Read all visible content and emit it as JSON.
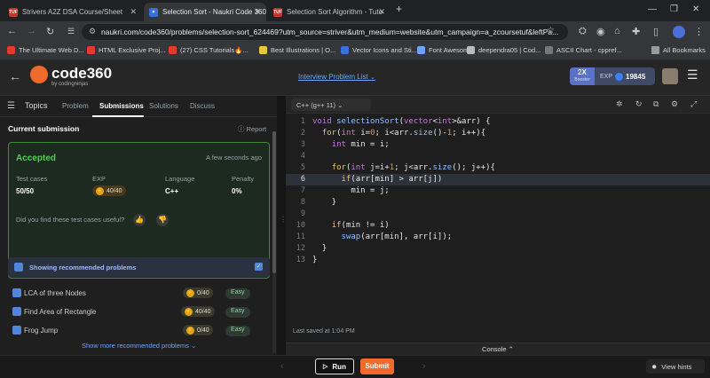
{
  "browser": {
    "tabs": [
      {
        "label": "Strivers A2Z DSA Course/Sheet",
        "active": false
      },
      {
        "label": "Selection Sort - Naukri Code 360",
        "active": true
      },
      {
        "label": "Selection Sort Algorithm - Tuto",
        "active": false
      }
    ],
    "url": "naukri.com/code360/problems/selection-sort_624469?utm_source=striver&utm_medium=website&utm_campaign=a_zcoursetuf&leftPa...",
    "bookmarks": [
      "The Ultimate Web D...",
      "HTML Exclusive Proj...",
      "(27) CSS Tutorials🔥...",
      "Best Illustrations | O...",
      "Vector Icons and Sti...",
      "Font Awesome",
      "deependra05 | Cod...",
      "ASCII Chart - cppref..."
    ],
    "all_bookmarks": "All Bookmarks"
  },
  "header": {
    "logo_main": "code",
    "logo_num": "360",
    "logo_sub": "by codingninjas",
    "center_link": "Interview Problem List",
    "booster_x": "2X",
    "booster_label": "Booster",
    "exp_label": "EXP",
    "exp_value": "19845"
  },
  "left": {
    "topics": "Topics",
    "tabs": [
      "Problem",
      "Submissions",
      "Solutions",
      "Discuss"
    ],
    "current_submission": "Current submission",
    "report": "Report",
    "status": "Accepted",
    "time": "A few seconds ago",
    "stats": [
      {
        "label": "Test cases",
        "value": "50/50"
      },
      {
        "label": "EXP",
        "value": "40/40"
      },
      {
        "label": "Language",
        "value": "C++"
      },
      {
        "label": "Penalty",
        "value": "0%"
      }
    ],
    "feedback_q": "Did you find these test cases useful?",
    "recommended_title": "Showing recommended problems",
    "recommended": [
      {
        "name": "LCA of three Nodes",
        "exp": "0/40",
        "difficulty": "Easy"
      },
      {
        "name": "Find Area of Rectangle",
        "exp": "40/40",
        "difficulty": "Easy"
      },
      {
        "name": "Frog Jump",
        "exp": "0/40",
        "difficulty": "Easy"
      }
    ],
    "show_more": "Show more recommended problems"
  },
  "editor": {
    "language": "C++ (g++ 11)",
    "line_numbers": [
      "1",
      "2",
      "3",
      "4",
      "5",
      "6",
      "7",
      "8",
      "9",
      "10",
      "11",
      "12",
      "13"
    ],
    "last_saved": "Last saved at 1:04 PM",
    "console": "Console"
  },
  "footer": {
    "run": "Run",
    "submit": "Submit",
    "view_hints": "View hints"
  },
  "colors": {
    "accepted": "#5cc85c",
    "submit_bg": "#f06b2b",
    "link_blue": "#6aa4ff"
  }
}
